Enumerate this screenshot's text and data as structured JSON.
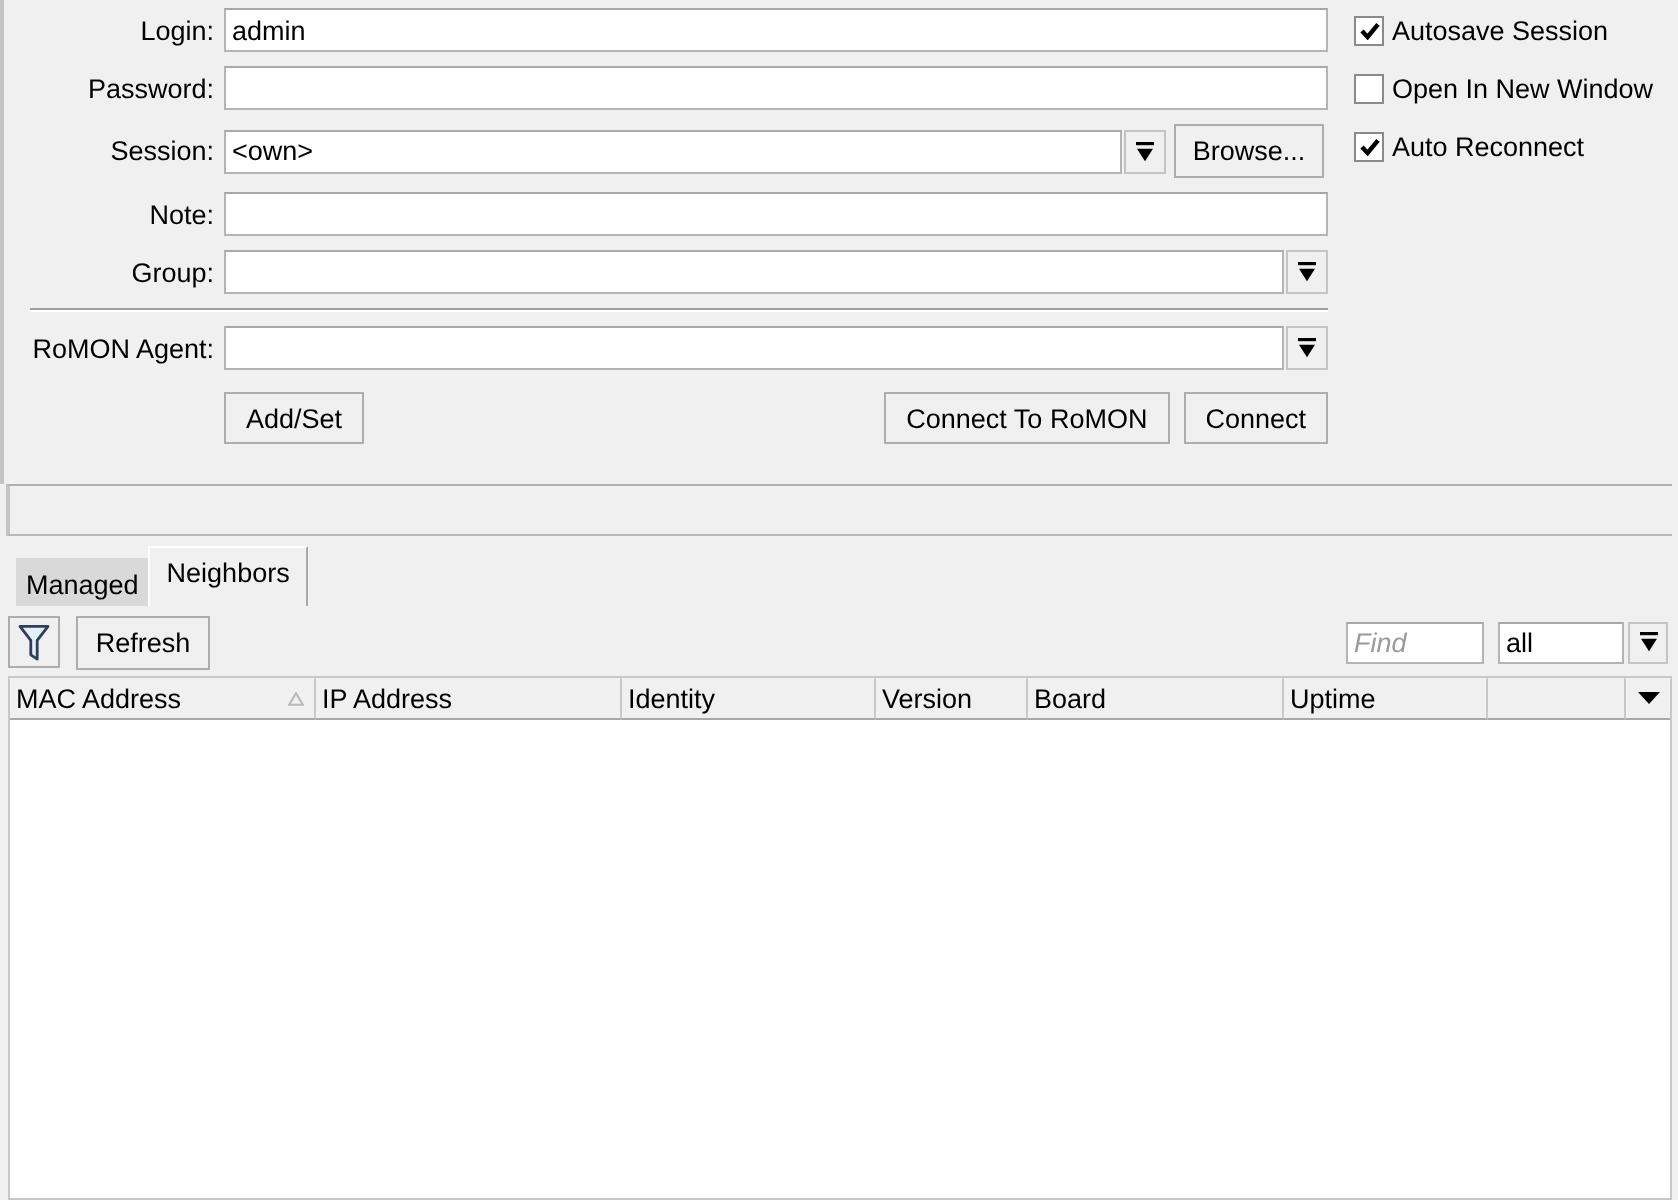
{
  "form": {
    "sections": [
      {
        "fields": [
          {
            "label": "Login:",
            "kind": "text",
            "value": "admin"
          },
          {
            "label": "Password:",
            "kind": "password"
          },
          {
            "label": "Session:",
            "kind": "combo",
            "value": "<own>",
            "button": "Browse..."
          },
          {
            "label": "Note:",
            "kind": "text"
          },
          {
            "label": "Group:",
            "kind": "combo"
          }
        ]
      },
      {
        "fields": [
          {
            "label": "RoMON Agent:",
            "kind": "combo"
          }
        ]
      }
    ],
    "buttons": [
      "Add/Set",
      "Connect To RoMON",
      "Connect"
    ]
  },
  "options": [
    {
      "label": "Autosave Session",
      "checked": true
    },
    {
      "label": "Open In New Window",
      "checked": false
    },
    {
      "label": "Auto Reconnect",
      "checked": true
    }
  ],
  "tabs": [
    {
      "label": "Managed",
      "selected": false
    },
    {
      "label": "Neighbors",
      "selected": true
    }
  ],
  "toolbar": {
    "refresh": "Refresh",
    "find": {
      "placeholder": "Find"
    },
    "filter": {
      "value": "all"
    }
  },
  "table": {
    "columns": [
      {
        "label": "MAC Address",
        "sorted": true
      },
      {
        "label": "IP Address",
        "sorted": false
      },
      {
        "label": "Identity",
        "sorted": false
      },
      {
        "label": "Version",
        "sorted": false
      },
      {
        "label": "Board",
        "sorted": false
      },
      {
        "label": "Uptime",
        "sorted": false
      }
    ]
  }
}
